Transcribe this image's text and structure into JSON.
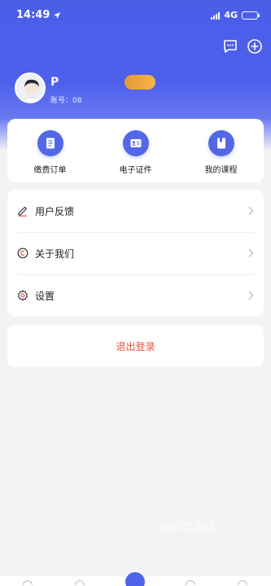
{
  "status_bar": {
    "time": "14:49",
    "network": "4G"
  },
  "header": {
    "icons": [
      "message-icon",
      "add-icon"
    ]
  },
  "profile": {
    "name": "P",
    "account_label": "账号：08"
  },
  "quick_actions": [
    {
      "label": "缴费订单",
      "icon": "document-icon"
    },
    {
      "label": "电子证件",
      "icon": "id-card-icon"
    },
    {
      "label": "我的课程",
      "icon": "book-icon"
    }
  ],
  "menu": [
    {
      "label": "用户反馈",
      "icon": "pencil-icon"
    },
    {
      "label": "关于我们",
      "icon": "copyright-icon"
    },
    {
      "label": "设置",
      "icon": "gear-icon"
    }
  ],
  "logout_label": "退出登录",
  "watermark": "365学法网",
  "colors": {
    "primary": "#4a5ee8",
    "logout": "#e4533b",
    "badge": "#f0a83e"
  }
}
